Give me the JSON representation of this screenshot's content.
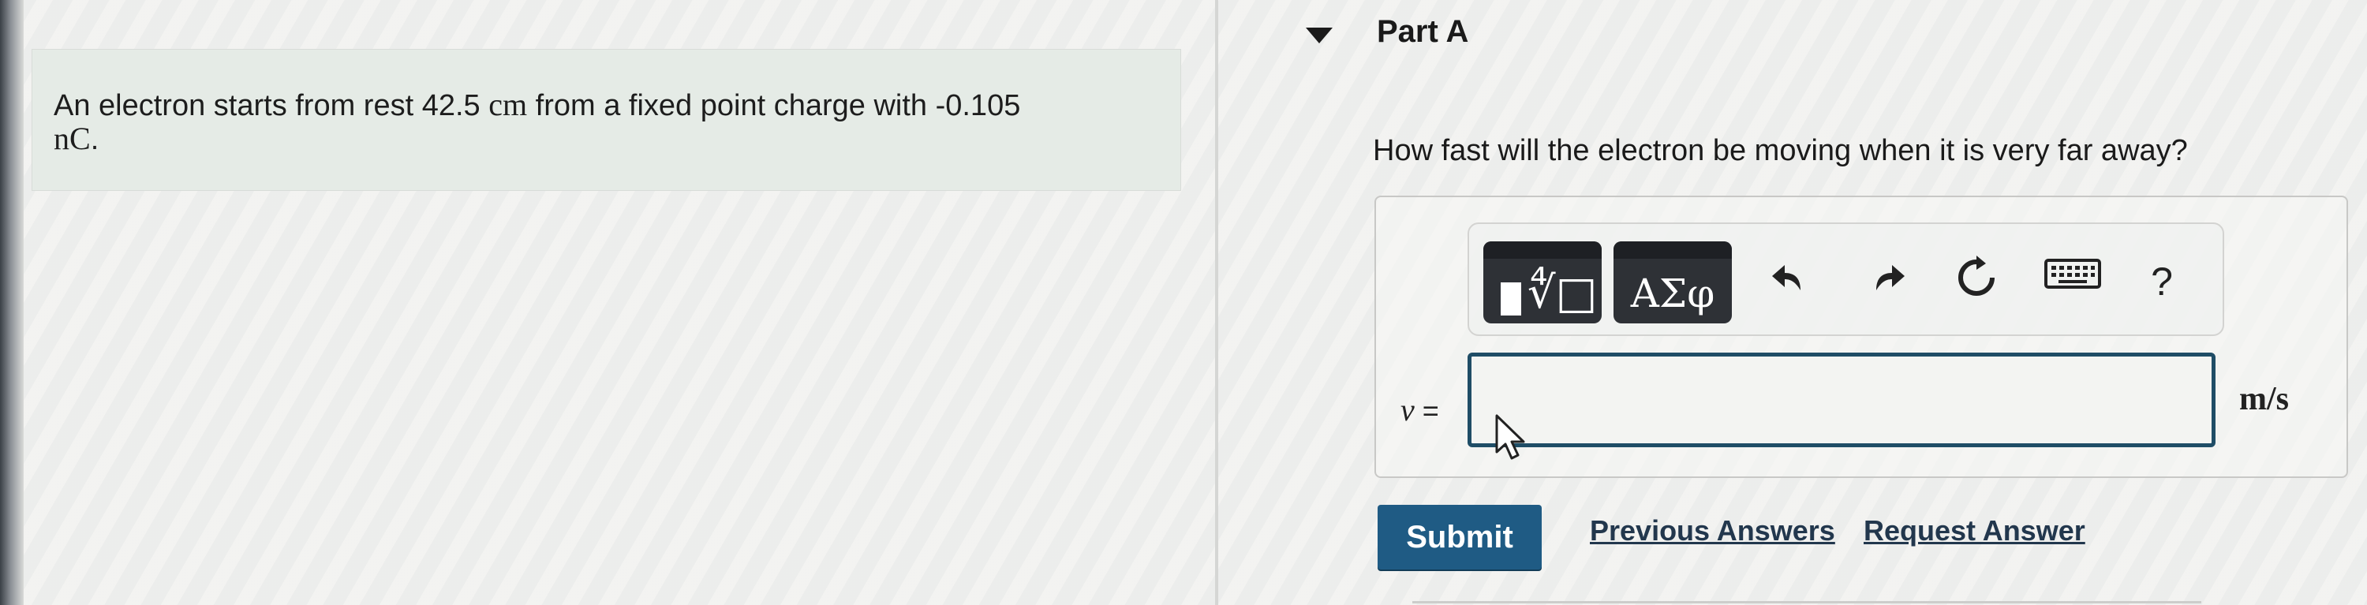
{
  "problem": {
    "text_before": "An electron starts from rest 42.5",
    "distance_unit": "cm",
    "text_middle": "from a fixed point charge with -0.105",
    "charge_unit": "nC",
    "text_end": "."
  },
  "part": {
    "title": "Part A",
    "toggle_icon": "caret-down-icon"
  },
  "question": "How fast will the electron be moving when it is very far away?",
  "toolbar": {
    "templates_icon": "templates-icon",
    "symbols_label": "ΑΣφ",
    "undo_icon": "undo-icon",
    "redo_icon": "redo-icon",
    "reset_icon": "reset-icon",
    "keyboard_icon": "keyboard-icon",
    "help_label": "?"
  },
  "answer": {
    "variable": "v",
    "equals": "=",
    "value": "",
    "unit": "m/s"
  },
  "actions": {
    "submit_label": "Submit",
    "previous_answers_label": "Previous Answers",
    "request_answer_label": "Request Answer"
  },
  "colors": {
    "submit_bg": "#1f5b84",
    "input_border": "#1f4d66",
    "problem_bg": "#e5ebe6",
    "toolbar_btn_bg": "#2e3136"
  }
}
